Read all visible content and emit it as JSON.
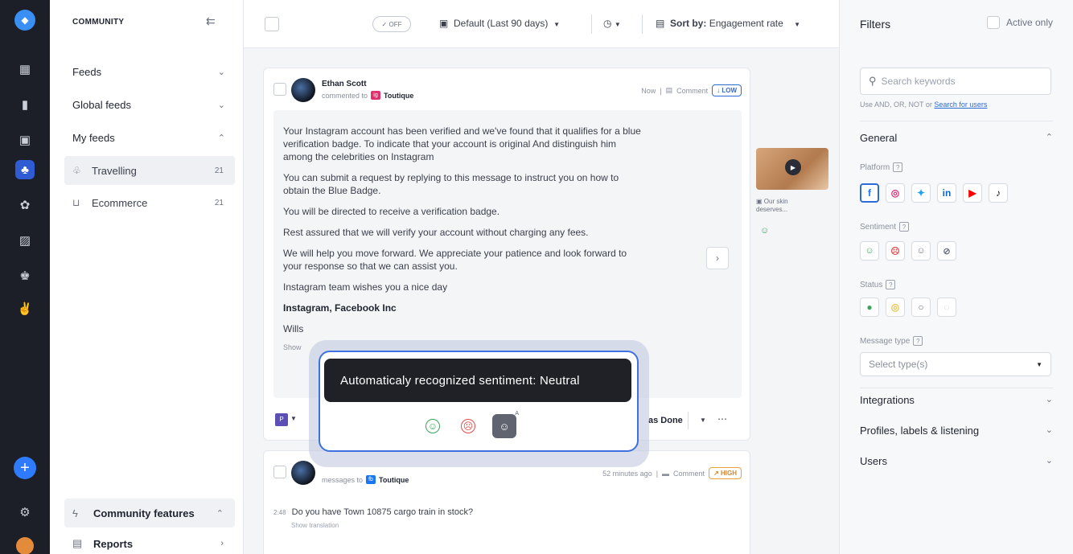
{
  "rail": {
    "icons": [
      "dashboard-icon",
      "analytics-icon",
      "calendar-icon",
      "community-icon",
      "support-icon",
      "media-icon",
      "listening-icon",
      "campaign-icon"
    ],
    "bottom_icons": [
      "settings-icon"
    ]
  },
  "sidebar": {
    "header": "COMMUNITY",
    "feeds_label": "Feeds",
    "global_feeds_label": "Global feeds",
    "my_feeds_label": "My feeds",
    "items": [
      {
        "label": "Travelling",
        "count": "21"
      },
      {
        "label": "Ecommerce",
        "count": "21"
      }
    ],
    "community_features_label": "Community features",
    "reports_label": "Reports"
  },
  "topbar": {
    "toggle_label": "OFF",
    "date_range": "Default (Last 90 days)",
    "sort_label": "Sort by:",
    "sort_value": "Engagement rate"
  },
  "card1": {
    "author": "Ethan Scott",
    "action": "commented to",
    "brand": "Toutique",
    "time": "Now",
    "type": "Comment",
    "priority": "LOW",
    "paragraphs": [
      "Your Instagram account has been verified and we've found that it qualifies for a blue verification badge. To indicate that your account is original And distinguish him among the celebrities on Instagram",
      "You can submit a request by replying to this message to instruct you on how to obtain the Blue Badge.",
      "You will be directed to receive a verification badge.",
      "Rest assured that we will verify your account without charging any fees.",
      "We will help you move forward. We appreciate your patience and look forward to your response so that we can assist you.",
      "Instagram team wishes you a nice day"
    ],
    "signature": "Instagram, Facebook Inc",
    "partial_line": "Wills",
    "show_more": "Show",
    "done_label": "as Done"
  },
  "media": {
    "caption": "Our skin deserves..."
  },
  "card2": {
    "action": "messages to",
    "brand": "Toutique",
    "time": "52 minutes ago",
    "type": "Comment",
    "priority": "HIGH",
    "msg_time": "2:48",
    "message": "Do you have Town 10875 cargo train in stock?",
    "translation": "Show translation"
  },
  "popover": {
    "tooltip": "Automaticaly recognized sentiment: Neutral"
  },
  "filters": {
    "title": "Filters",
    "active_only": "Active only",
    "search_placeholder": "Search keywords",
    "hint_prefix": "Use AND, OR, NOT or",
    "hint_link": "Search for users",
    "general": "General",
    "platform_label": "Platform",
    "sentiment_label": "Sentiment",
    "status_label": "Status",
    "message_type_label": "Message type",
    "message_type_placeholder": "Select type(s)",
    "integrations": "Integrations",
    "profiles_labels": "Profiles, labels & listening",
    "users": "Users",
    "platforms": [
      {
        "name": "facebook",
        "glyph": "f",
        "color": "#1877f2"
      },
      {
        "name": "instagram",
        "glyph": "◎",
        "color": "#d62976"
      },
      {
        "name": "twitter",
        "glyph": "✦",
        "color": "#1da1f2"
      },
      {
        "name": "linkedin",
        "glyph": "in",
        "color": "#0a66c2"
      },
      {
        "name": "youtube",
        "glyph": "▶",
        "color": "#ff0000"
      },
      {
        "name": "tiktok",
        "glyph": "♪",
        "color": "#111111"
      }
    ]
  },
  "colors": {
    "accent": "#2f6bd6",
    "rail": "#1c1f27",
    "positive": "#3aa55d",
    "negative": "#e04b4b"
  }
}
